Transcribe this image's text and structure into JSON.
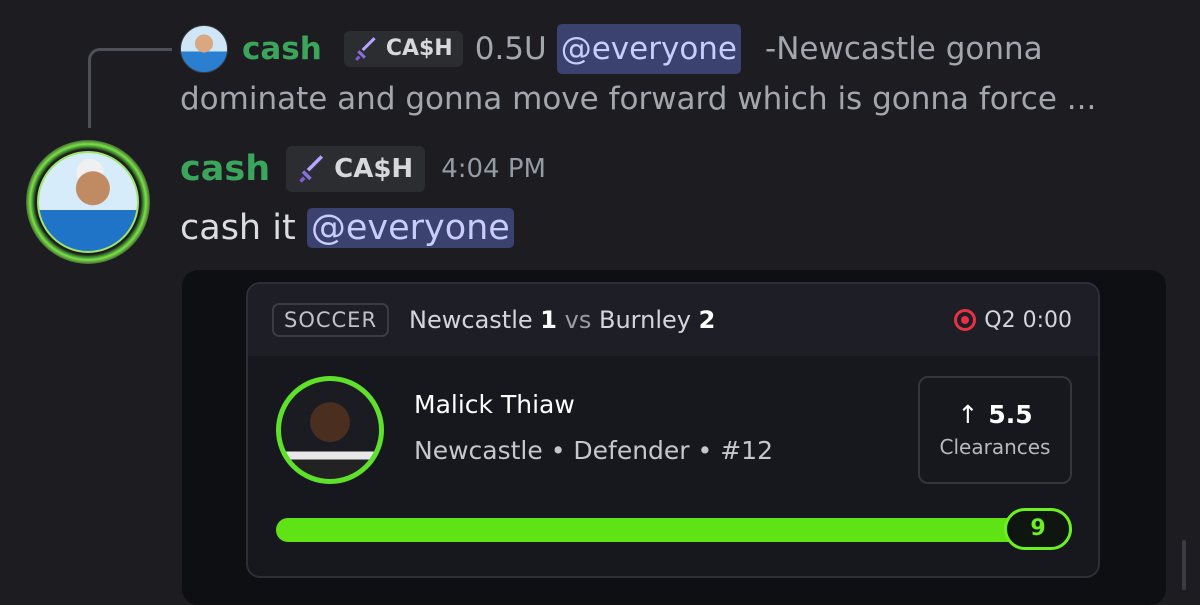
{
  "reply": {
    "username": "cash",
    "role_tag": "CA$H",
    "prefix": "0.5U",
    "mention": "@everyone",
    "preview_first": "-Newcastle gonna",
    "preview_second": "dominate and gonna move forward which is gonna force ..."
  },
  "message": {
    "username": "cash",
    "role_tag": "CA$H",
    "timestamp": "4:04 PM",
    "text": "cash it",
    "mention": "@everyone"
  },
  "embed": {
    "sport": "SOCCER",
    "team_home": "Newcastle",
    "score_home": "1",
    "vs": "vs",
    "team_away": "Burnley",
    "score_away": "2",
    "game_clock": "Q2 0:00",
    "player_name": "Malick Thiaw",
    "player_meta": "Newcastle • Defender • #12",
    "line_value": "5.5",
    "line_direction_icon": "arrow-up-icon",
    "stat_label": "Clearances",
    "current_value": "9",
    "progress_fraction": 1.0
  },
  "colors": {
    "username": "#3ba55c",
    "mention_bg": "#3c4270",
    "progress": "#5fe314",
    "live": "#e63244"
  }
}
